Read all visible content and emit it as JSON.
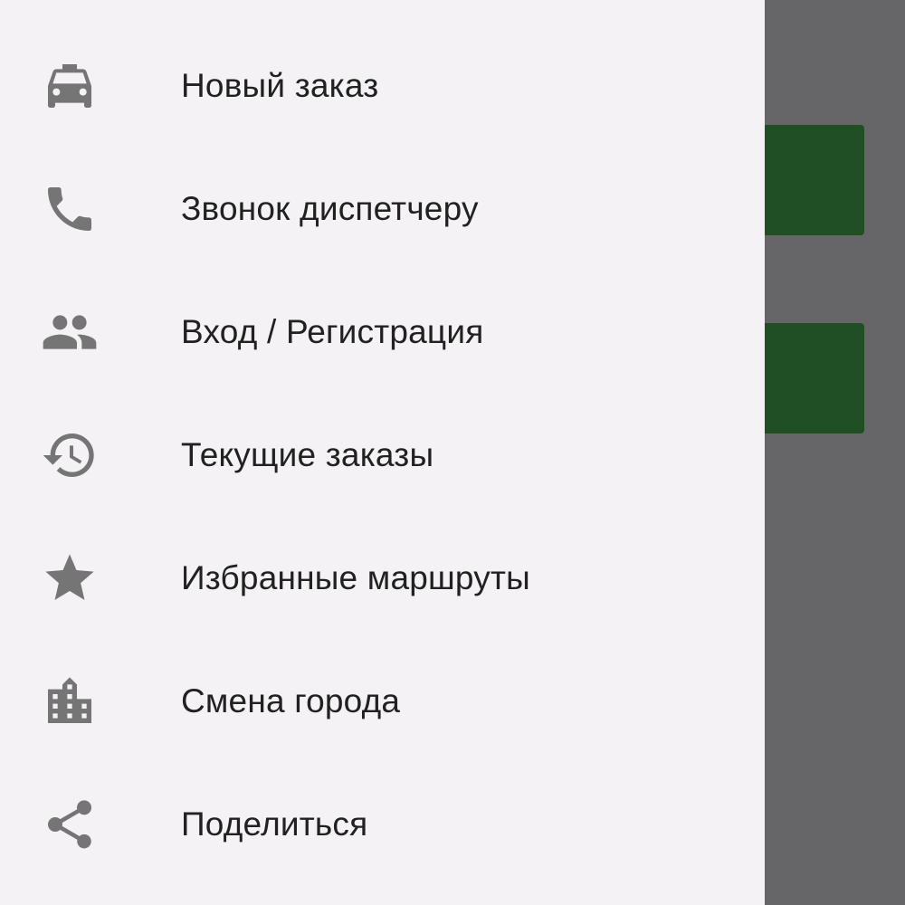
{
  "drawer": {
    "items": [
      {
        "label": "Новый заказ",
        "icon": "taxi-icon"
      },
      {
        "label": "Звонок диспетчеру",
        "icon": "phone-icon"
      },
      {
        "label": "Вход / Регистрация",
        "icon": "people-icon"
      },
      {
        "label": "Текущие заказы",
        "icon": "history-icon"
      },
      {
        "label": "Избранные маршруты",
        "icon": "star-icon"
      },
      {
        "label": "Смена города",
        "icon": "city-icon"
      },
      {
        "label": "Поделиться",
        "icon": "share-icon"
      }
    ]
  },
  "colors": {
    "drawer_background": "#f4f2f5",
    "scrim": "#666567",
    "accent_green": "#214f24",
    "icon_gray": "#757575",
    "text": "#212121"
  }
}
